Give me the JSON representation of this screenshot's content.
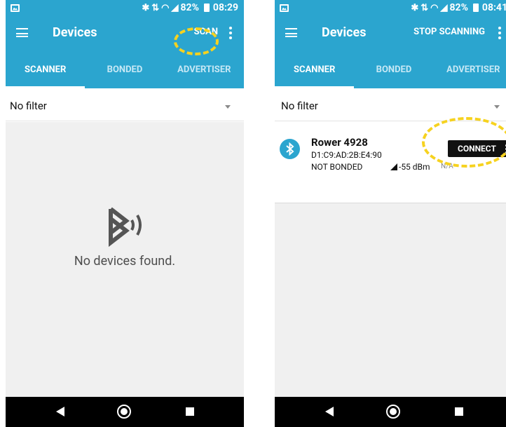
{
  "phone1": {
    "status": {
      "battery": "82%",
      "time": "08:29",
      "bluetooth_icon": "bluetooth-icon",
      "wifi_icon": "wifi-icon",
      "signal_icon": "cell-signal-icon"
    },
    "app_bar": {
      "title": "Devices",
      "action": "SCAN"
    },
    "tabs": [
      {
        "label": "SCANNER",
        "active": true
      },
      {
        "label": "BONDED",
        "active": false
      },
      {
        "label": "ADVERTISER",
        "active": false
      }
    ],
    "filter": {
      "label": "No filter"
    },
    "empty_message": "No devices found."
  },
  "phone2": {
    "status": {
      "battery": "82%",
      "time": "08:41",
      "bluetooth_icon": "bluetooth-icon",
      "wifi_icon": "wifi-icon",
      "signal_icon": "cell-signal-icon"
    },
    "app_bar": {
      "title": "Devices",
      "action": "STOP SCANNING"
    },
    "tabs": [
      {
        "label": "SCANNER",
        "active": true
      },
      {
        "label": "BONDED",
        "active": false
      },
      {
        "label": "ADVERTISER",
        "active": false
      }
    ],
    "filter": {
      "label": "No filter"
    },
    "device": {
      "name": "Rower 4928",
      "address": "D1:C9:AD:2B:E4:90",
      "bond_state": "NOT BONDED",
      "rssi": "-55 dBm",
      "interval": "N/A",
      "connect_label": "CONNECT"
    }
  },
  "colors": {
    "primary": "#2ba5cf",
    "highlight": "#f6d21f",
    "nav_bar": "#000000",
    "content_bg": "#f0f0f0"
  }
}
